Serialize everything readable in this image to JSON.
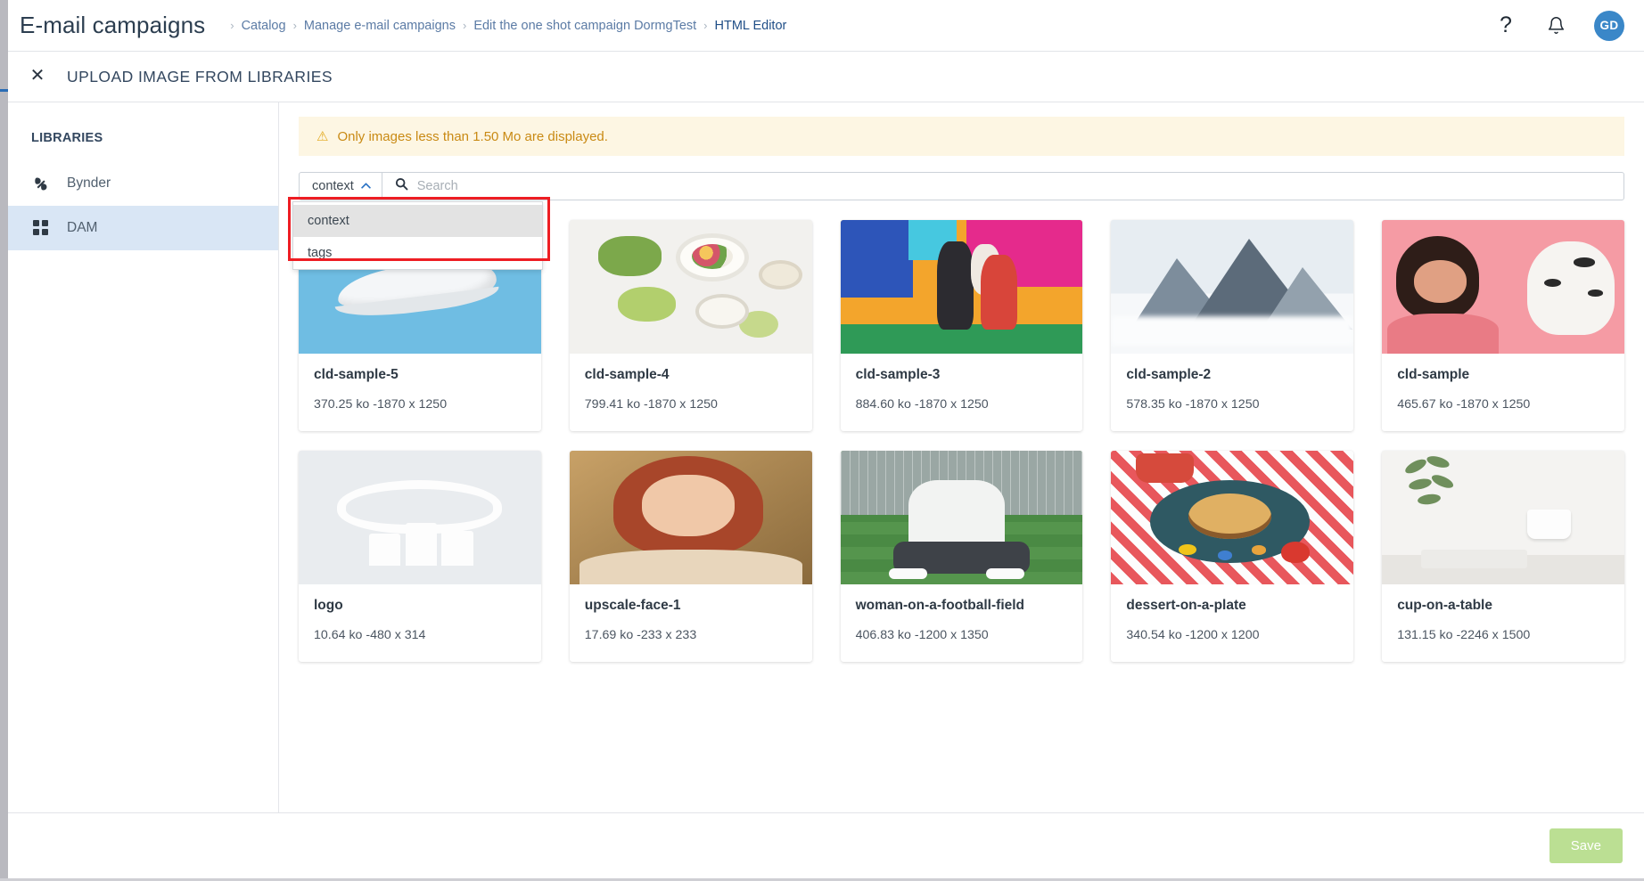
{
  "topbar": {
    "app_title": "E-mail campaigns",
    "breadcrumb": [
      "Catalog",
      "Manage e-mail campaigns",
      "Edit the one shot campaign DormgTest",
      "HTML Editor"
    ],
    "separator": "›",
    "help_icon": "?",
    "help_icon_name": "help-icon",
    "bell_icon_name": "notifications-bell-icon",
    "avatar_initials": "GD"
  },
  "modal": {
    "close_icon": "✕",
    "title": "UPLOAD IMAGE FROM LIBRARIES"
  },
  "sidebar": {
    "heading": "LIBRARIES",
    "items": [
      {
        "label": "Bynder",
        "icon": "bynder-logo-icon",
        "active": false
      },
      {
        "label": "DAM",
        "icon": "grid-squares-icon",
        "active": true
      }
    ]
  },
  "warning": {
    "icon": "⚠",
    "text": "Only images less than 1.50 Mo are displayed."
  },
  "search": {
    "selected_field": "context",
    "caret_icon": "⌃",
    "search_icon": "search-icon",
    "placeholder": "Search",
    "value": "",
    "dropdown_open": true,
    "options": [
      "context",
      "tags"
    ],
    "highlight_color": "#ee1d23"
  },
  "grid": {
    "items": [
      {
        "title": "cld-sample-5",
        "meta": "370.25 ko -1870 x 1250",
        "art": "art-shoe"
      },
      {
        "title": "cld-sample-4",
        "meta": "799.41 ko -1870 x 1250",
        "art": "art-food"
      },
      {
        "title": "cld-sample-3",
        "meta": "884.60 ko -1870 x 1250",
        "art": "art-bball"
      },
      {
        "title": "cld-sample-2",
        "meta": "578.35 ko -1870 x 1250",
        "art": "art-mtn"
      },
      {
        "title": "cld-sample",
        "meta": "465.67 ko -1870 x 1250",
        "art": "art-pink"
      },
      {
        "title": "logo",
        "meta": "10.64 ko -480 x 314",
        "art": "art-logo"
      },
      {
        "title": "upscale-face-1",
        "meta": "17.69 ko -233 x 233",
        "art": "art-face"
      },
      {
        "title": "woman-on-a-football-field",
        "meta": "406.83 ko -1200 x 1350",
        "art": "art-field"
      },
      {
        "title": "dessert-on-a-plate",
        "meta": "340.54 ko -1200 x 1200",
        "art": "art-dessert"
      },
      {
        "title": "cup-on-a-table",
        "meta": "131.15 ko -2246 x 1500",
        "art": "art-cup"
      }
    ]
  },
  "footer": {
    "save_label": "Save",
    "save_color": "#bbdf93"
  },
  "edge": {
    "chevron": "⌄"
  }
}
